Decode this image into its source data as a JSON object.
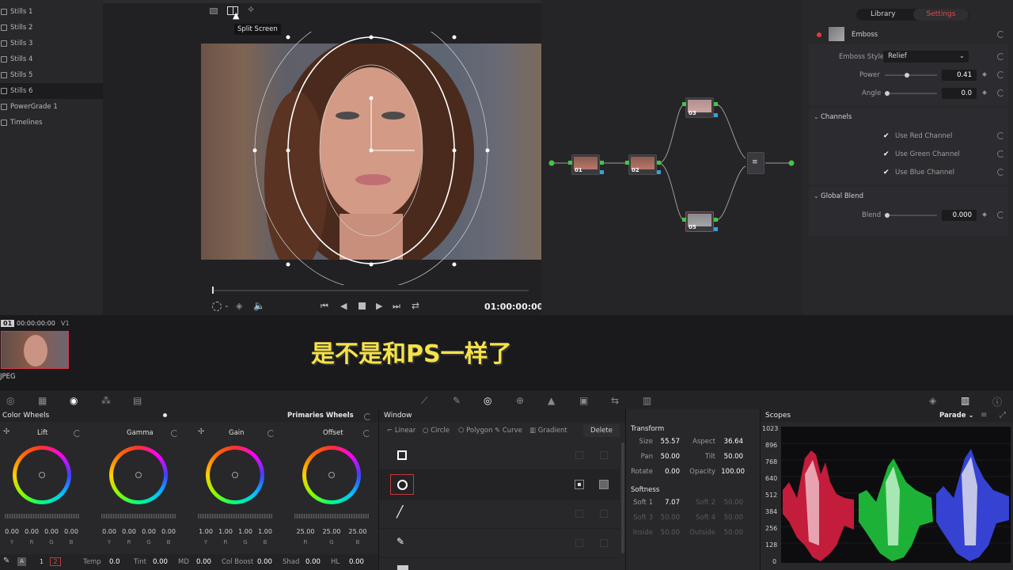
{
  "stills": {
    "items": [
      {
        "label": "Stills 1"
      },
      {
        "label": "Stills 2"
      },
      {
        "label": "Stills 3"
      },
      {
        "label": "Stills 4"
      },
      {
        "label": "Stills 5"
      },
      {
        "label": "Stills 6"
      },
      {
        "label": "PowerGrade 1"
      },
      {
        "label": "Timelines"
      }
    ],
    "active_index": 5
  },
  "viewer": {
    "tooltip": "Split Screen",
    "timecode": "01:00:00:00"
  },
  "nodes": {
    "items": [
      {
        "label": "01"
      },
      {
        "label": "02"
      },
      {
        "label": "03"
      },
      {
        "label": "05"
      }
    ]
  },
  "effects": {
    "tabs": [
      {
        "label": "Library"
      },
      {
        "label": "Settings"
      }
    ],
    "active_tab": 1,
    "effect_name": "Emboss",
    "emboss_style_label": "Emboss Style",
    "emboss_style_value": "Relief",
    "power_label": "Power",
    "power_value": "0.41",
    "angle_label": "Angle",
    "angle_value": "0.0",
    "channels_header": "Channels",
    "use_red_label": "Use Red Channel",
    "use_green_label": "Use Green Channel",
    "use_blue_label": "Use Blue Channel",
    "global_blend_header": "Global Blend",
    "blend_label": "Blend",
    "blend_value": "0.000",
    "power_fraction": 0.41,
    "blend_fraction": 0
  },
  "timeline": {
    "clip_index": "01",
    "clip_timecode": "00:00:00:00",
    "track": "V1",
    "clip_format": "JPEG",
    "subtitle": "是不是和PS一样了"
  },
  "color_wheels": {
    "title": "Color Wheels",
    "mode": "Primaries Wheels",
    "wheels": [
      {
        "name": "Lift",
        "values": [
          "0.00",
          "0.00",
          "0.00",
          "0.00"
        ],
        "channels": [
          "Y",
          "R",
          "G",
          "B"
        ]
      },
      {
        "name": "Gamma",
        "values": [
          "0.00",
          "0.00",
          "0.00",
          "0.00"
        ],
        "channels": [
          "Y",
          "R",
          "G",
          "B"
        ]
      },
      {
        "name": "Gain",
        "values": [
          "1.00",
          "1.00",
          "1.00",
          "1.00"
        ],
        "channels": [
          "Y",
          "R",
          "G",
          "B"
        ]
      },
      {
        "name": "Offset",
        "values": [
          "25.00",
          "25.00",
          "25.00"
        ],
        "channels": [
          "R",
          "G",
          "B"
        ]
      }
    ],
    "bottom": {
      "page_a": "1",
      "page_b": "2",
      "temp_label": "Temp",
      "temp_value": "0.0",
      "tint_label": "Tint",
      "tint_value": "0.00",
      "md_label": "MD",
      "md_value": "0.00",
      "colboost_label": "Col Boost",
      "colboost_value": "0.00",
      "shad_label": "Shad",
      "shad_value": "0.00",
      "hl_label": "HL",
      "hl_value": "0.00"
    }
  },
  "window": {
    "title": "Window",
    "tools": [
      {
        "label": "Linear"
      },
      {
        "label": "Circle"
      },
      {
        "label": "Polygon"
      },
      {
        "label": "Curve"
      },
      {
        "label": "Gradient"
      }
    ],
    "delete_label": "Delete"
  },
  "transform": {
    "title": "Transform",
    "size_label": "Size",
    "size_value": "55.57",
    "aspect_label": "Aspect",
    "aspect_value": "36.64",
    "pan_label": "Pan",
    "pan_value": "50.00",
    "tilt_label": "Tilt",
    "tilt_value": "50.00",
    "rotate_label": "Rotate",
    "rotate_value": "0.00",
    "opacity_label": "Opacity",
    "opacity_value": "100.00",
    "softness_title": "Softness",
    "soft1_label": "Soft 1",
    "soft1_value": "7.07",
    "soft2_label": "Soft 2",
    "soft2_value": "50.00",
    "soft3_label": "Soft 3",
    "soft3_value": "50.00",
    "soft4_label": "Soft 4",
    "soft4_value": "50.00",
    "inside_label": "Inside",
    "inside_value": "50.00",
    "outside_label": "Outside",
    "outside_value": "50.00"
  },
  "scopes": {
    "title": "Scopes",
    "mode": "Parade",
    "ticks": [
      "1023",
      "896",
      "768",
      "640",
      "512",
      "384",
      "256",
      "128",
      "0"
    ]
  }
}
